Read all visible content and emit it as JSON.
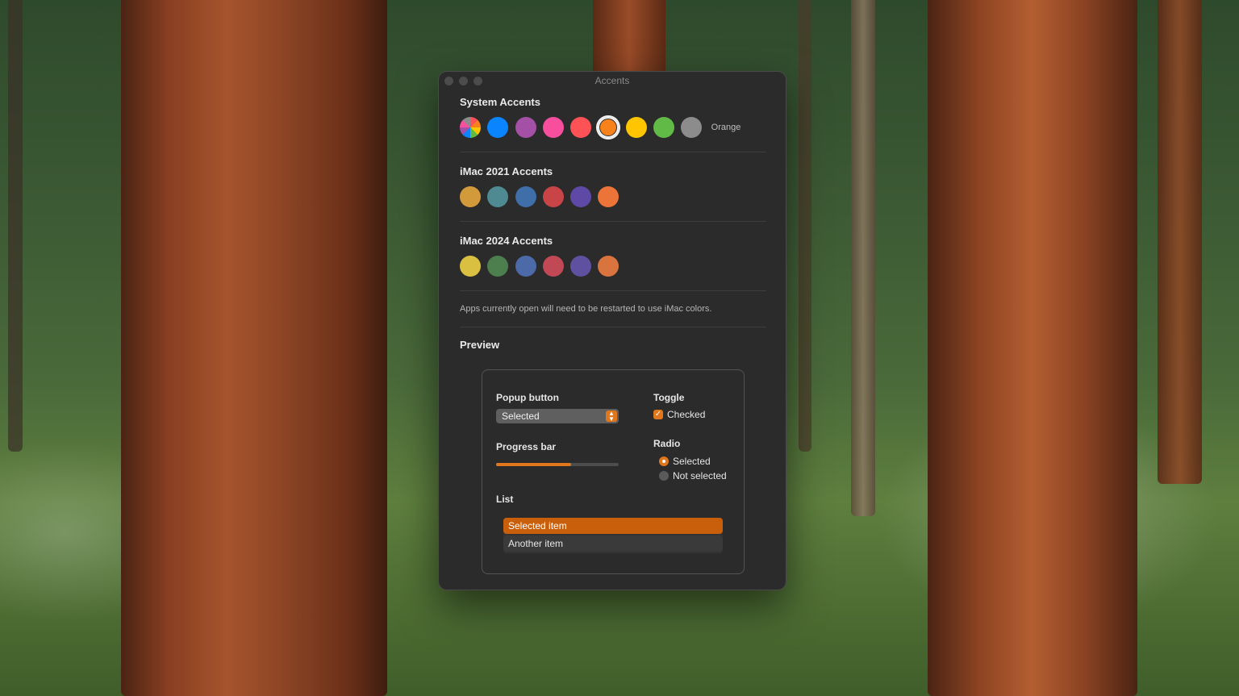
{
  "window": {
    "title": "Accents"
  },
  "system_accents": {
    "title": "System Accents",
    "selected_label": "Orange",
    "swatches": [
      {
        "name": "multicolor",
        "color": "conic"
      },
      {
        "name": "blue",
        "color": "#0a84ff"
      },
      {
        "name": "purple",
        "color": "#a550a7"
      },
      {
        "name": "pink",
        "color": "#f74f9e"
      },
      {
        "name": "red",
        "color": "#ff5257"
      },
      {
        "name": "orange",
        "color": "#f7821b",
        "selected": true
      },
      {
        "name": "yellow",
        "color": "#ffc600"
      },
      {
        "name": "green",
        "color": "#62ba46"
      },
      {
        "name": "graphite",
        "color": "#8c8c8c"
      }
    ]
  },
  "imac2021": {
    "title": "iMac 2021 Accents",
    "swatches": [
      "#d39a3c",
      "#4f8a92",
      "#3f6ea8",
      "#c94447",
      "#5e4aa6",
      "#ec7438"
    ]
  },
  "imac2024": {
    "title": "iMac 2024 Accents",
    "swatches": [
      "#d9c040",
      "#4d7f4e",
      "#4d6aa8",
      "#c04955",
      "#5f51a0",
      "#d9743f"
    ]
  },
  "note": "Apps currently open will need to be restarted to use iMac colors.",
  "preview": {
    "title": "Preview",
    "popup_label": "Popup button",
    "popup_value": "Selected",
    "progress_label": "Progress bar",
    "progress_value": 0.61,
    "toggle_label": "Toggle",
    "checkbox_label": "Checked",
    "radio_label": "Radio",
    "radio_selected": "Selected",
    "radio_unselected": "Not selected",
    "list_label": "List",
    "list_items": [
      "Selected item",
      "Another item"
    ]
  },
  "accent_color": "#e0771c"
}
